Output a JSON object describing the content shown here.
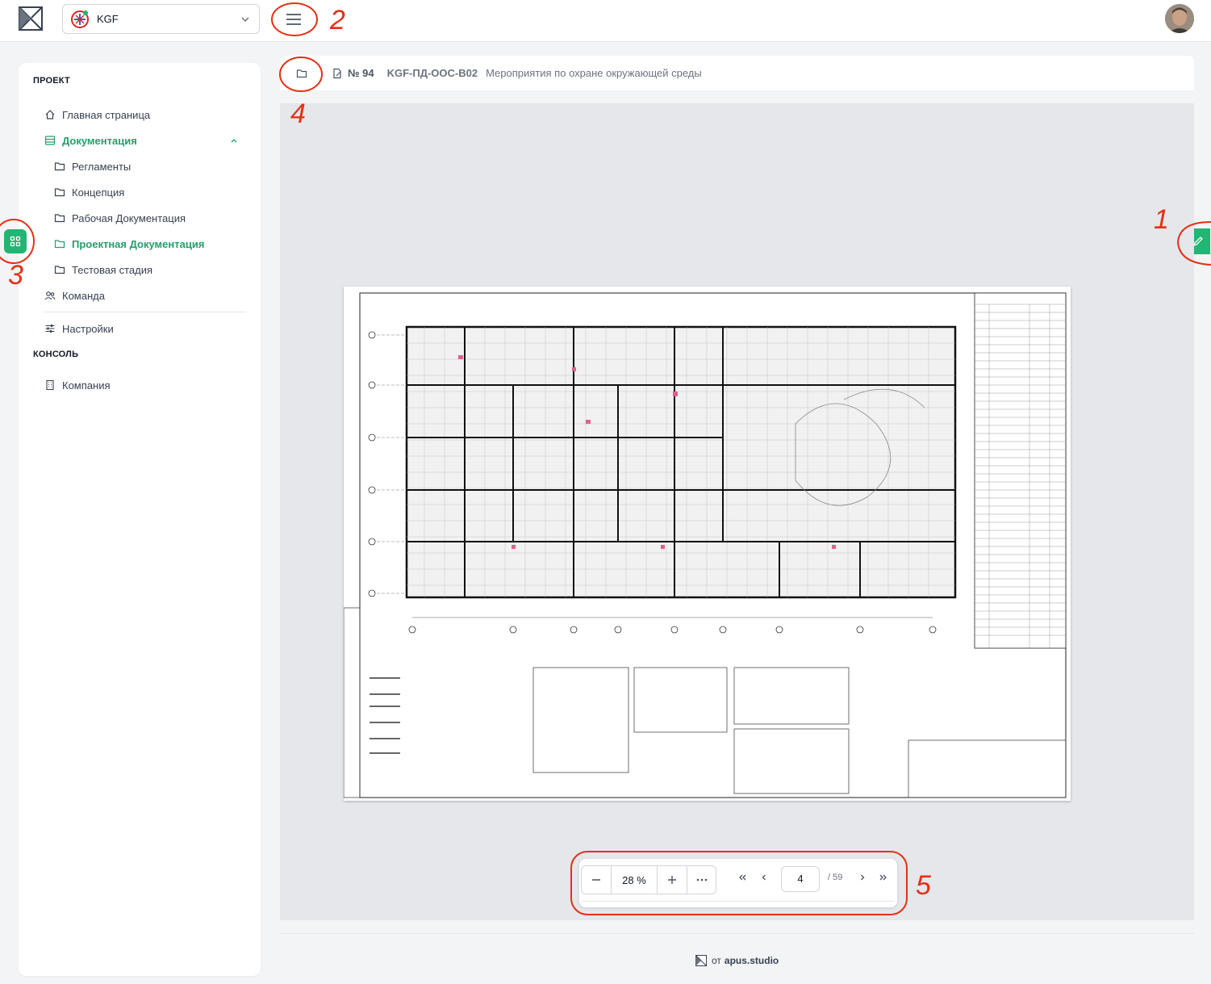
{
  "header": {
    "project_name": "KGF",
    "avatar": "user-avatar"
  },
  "sidebar": {
    "project_section": "ПРОЕКТ",
    "items": [
      {
        "label": "Главная страница",
        "icon": "home-icon"
      },
      {
        "label": "Документация",
        "icon": "docs-icon",
        "active": true
      },
      {
        "label": "Регламенты",
        "icon": "folder-icon"
      },
      {
        "label": "Концепция",
        "icon": "folder-icon"
      },
      {
        "label": "Рабочая Документация",
        "icon": "folder-icon"
      },
      {
        "label": "Проектная Документация",
        "icon": "folder-icon",
        "active": true
      },
      {
        "label": "Тестовая стадия",
        "icon": "folder-icon"
      },
      {
        "label": "Команда",
        "icon": "team-icon"
      },
      {
        "label": "Настройки",
        "icon": "sliders-icon"
      }
    ],
    "console_section": "КОНСОЛЬ",
    "console_items": [
      {
        "label": "Компания",
        "icon": "building-icon"
      }
    ]
  },
  "document": {
    "number": "№ 94",
    "code": "KGF-ПД-ООС-В02",
    "title": "Мероприятия по охране окружающей среды"
  },
  "toolbar": {
    "zoom": "28 %",
    "page": "4",
    "total": "/ 59"
  },
  "footer": {
    "prefix": "от",
    "brand": "apus.studio"
  },
  "colors": {
    "accent": "#22b573",
    "annotation": "#e53015"
  },
  "annotations": [
    "1",
    "2",
    "3",
    "4",
    "5"
  ]
}
